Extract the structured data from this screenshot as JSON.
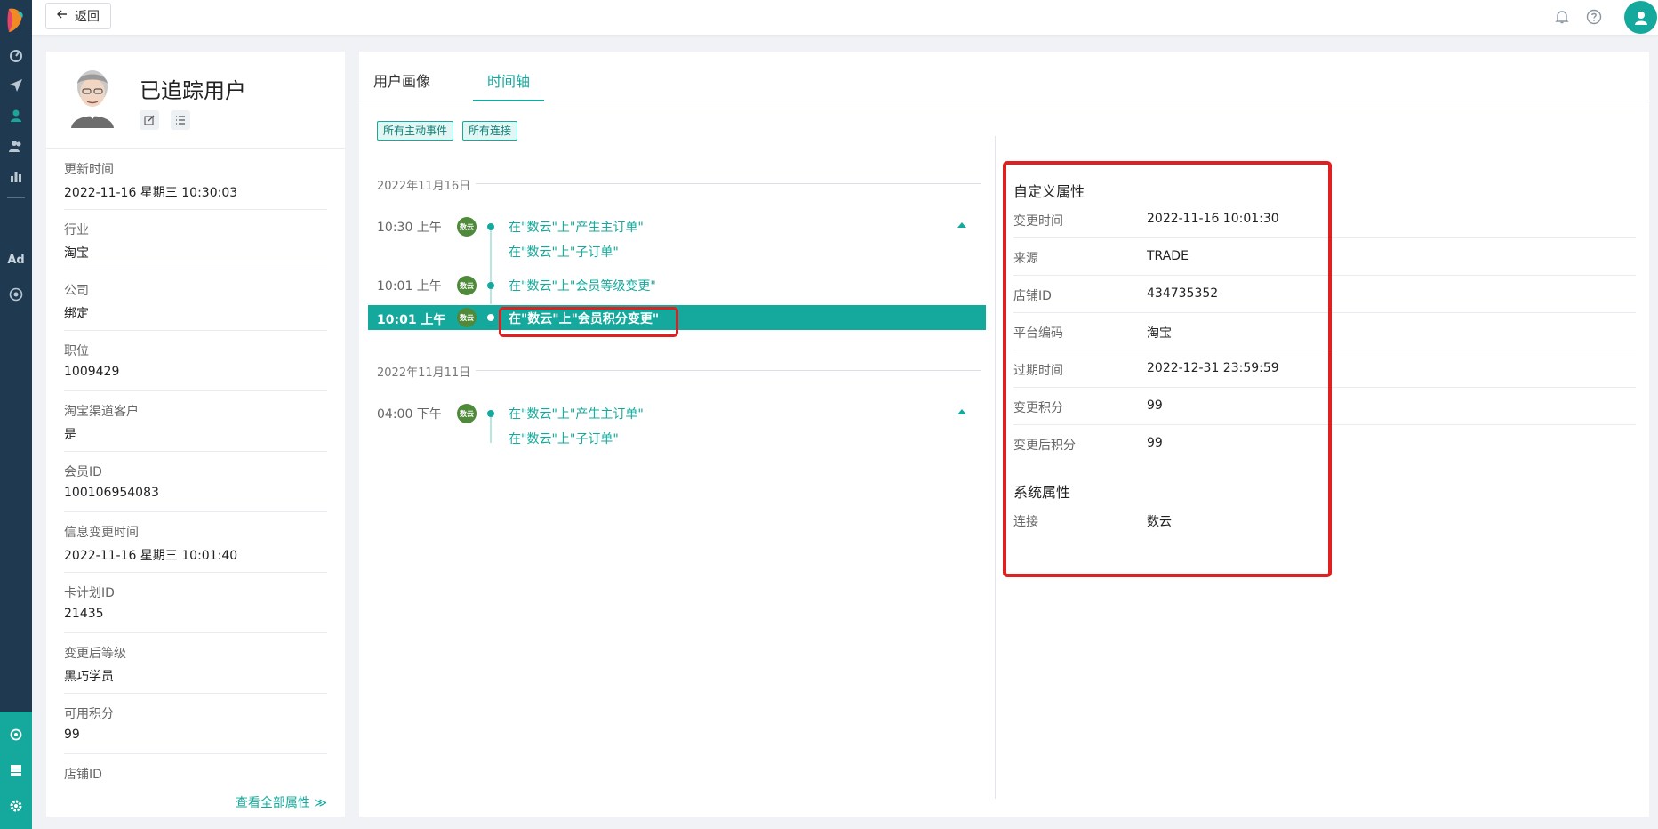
{
  "topbar": {
    "back_label": "返回"
  },
  "rail": {
    "ad_label": "Ad"
  },
  "profile": {
    "name": "已追踪用户",
    "attributes": [
      {
        "key": "更新时间",
        "value": "2022-11-16 星期三 10:30:03"
      },
      {
        "key": "行业",
        "value": "淘宝"
      },
      {
        "key": "公司",
        "value": "绑定"
      },
      {
        "key": "职位",
        "value": "1009429"
      },
      {
        "key": "淘宝渠道客户",
        "value": "是"
      },
      {
        "key": "会员ID",
        "value": "100106954083"
      },
      {
        "key": "信息变更时间",
        "value": "2022-11-16 星期三 10:01:40"
      },
      {
        "key": "卡计划ID",
        "value": "21435"
      },
      {
        "key": "变更后等级",
        "value": "黑巧学员"
      },
      {
        "key": "可用积分",
        "value": "99"
      },
      {
        "key": "店铺ID",
        "value": ""
      }
    ],
    "view_all_label": "查看全部属性 ≫"
  },
  "tabs": {
    "profile_tab": "用户画像",
    "timeline_tab": "时间轴"
  },
  "filters": {
    "chip1": "所有主动事件",
    "chip2": "所有连接"
  },
  "timeline": {
    "badge_label": "数云",
    "groups": [
      {
        "date": "2022年11月16日",
        "events": [
          {
            "time": "10:30 上午",
            "lines": [
              "在\"数云\"上\"产生主订单\"",
              "在\"数云\"上\"子订单\""
            ]
          },
          {
            "time": "10:01 上午",
            "lines": [
              "在\"数云\"上\"会员等级变更\""
            ]
          },
          {
            "time": "10:01 上午",
            "lines": [
              "在\"数云\"上\"会员积分变更\""
            ]
          }
        ]
      },
      {
        "date": "2022年11月11日",
        "events": [
          {
            "time": "04:00 下午",
            "lines": [
              "在\"数云\"上\"产生主订单\"",
              "在\"数云\"上\"子订单\""
            ]
          }
        ]
      }
    ]
  },
  "detail": {
    "custom_title": "自定义属性",
    "custom": [
      {
        "key": "变更时间",
        "value": "2022-11-16 10:01:30"
      },
      {
        "key": "来源",
        "value": "TRADE"
      },
      {
        "key": "店铺ID",
        "value": "434735352"
      },
      {
        "key": "平台编码",
        "value": "淘宝"
      },
      {
        "key": "过期时间",
        "value": "2022-12-31 23:59:59"
      },
      {
        "key": "变更积分",
        "value": "99"
      },
      {
        "key": "变更后积分",
        "value": "99"
      }
    ],
    "system_title": "系统属性",
    "system": [
      {
        "key": "连接",
        "value": "数云"
      }
    ]
  },
  "colors": {
    "accent": "#14a99c",
    "rail": "#1f3a50",
    "highlight": "#e02020"
  }
}
